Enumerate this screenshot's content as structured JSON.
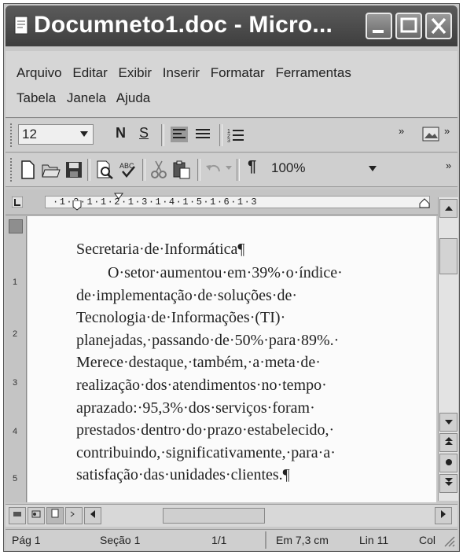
{
  "window": {
    "title": "Documneto1.doc - Micro..."
  },
  "menu": {
    "row1": [
      "Arquivo",
      "Editar",
      "Exibir",
      "Inserir",
      "Formatar",
      "Ferramentas"
    ],
    "row2": [
      "Tabela",
      "Janela",
      "Ajuda"
    ]
  },
  "formatting_toolbar": {
    "font_size": "12",
    "bold_label": "N",
    "underline_label": "S"
  },
  "standard_toolbar": {
    "zoom": "100%",
    "paragraph_mark": "¶"
  },
  "ruler": {
    "text": "·1·2·1·1·2·1·3·1·4·1·5·1·6·1·3"
  },
  "vertical_ruler": [
    "1",
    "2",
    "3",
    "4",
    "5"
  ],
  "document": {
    "first_line": "Secretaria·de·Informática¶",
    "lines": [
      "        O·setor·aumentou·em·39%·o·índice·",
      "de·implementação·de·soluções·de·",
      "Tecnologia·de·Informações·(TI)·",
      "planejadas,·passando·de·50%·para·89%.·",
      "Merece·destaque,·também,·a·meta·de·",
      "realização·dos·atendimentos·no·tempo·",
      "aprazado:·95,3%·dos·serviços·foram·",
      "prestados·dentro·do·prazo·estabelecido,·",
      "contribuindo,·significativamente,·para·a·",
      "satisfação·das·unidades·clientes.¶"
    ]
  },
  "statusbar": {
    "page": "Pág 1",
    "section": "Seção 1",
    "pages": "1/1",
    "position": "Em 7,3 cm",
    "line": "Lin 11",
    "column": "Col"
  }
}
